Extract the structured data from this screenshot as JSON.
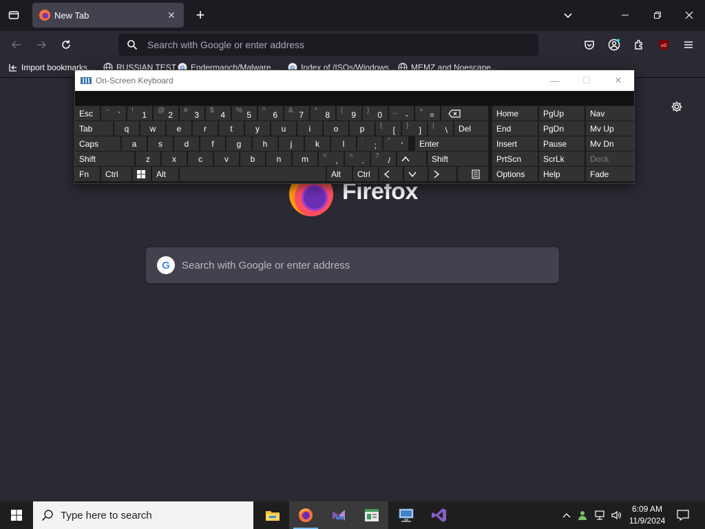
{
  "browser": {
    "tab": {
      "title": "New Tab",
      "close": "✕"
    },
    "new_tab": "+",
    "window_controls": {
      "minimize": "—",
      "restore": "❐",
      "close": "✕"
    },
    "urlbar": {
      "placeholder": "Search with Google or enter address"
    },
    "bookmarks": [
      {
        "label": "Import bookmarks...",
        "icon": "import-icon"
      },
      {
        "label": "RUSSIAN TEST",
        "icon": "globe-icon"
      },
      {
        "label": "Endermanch/Malware...",
        "icon": "google-icon"
      },
      {
        "label": "Index of /ISOs/Windows...",
        "icon": "google-icon"
      },
      {
        "label": "MEMZ and Noescape...",
        "icon": "globe-icon"
      }
    ]
  },
  "newtab": {
    "brand": "Firefox",
    "search_placeholder": "Search with Google or enter address"
  },
  "osk": {
    "title": "On-Screen Keyboard",
    "rows": {
      "row1": [
        "Esc",
        "Home",
        "PgUp",
        "Nav"
      ],
      "row2": [
        "Tab",
        "q",
        "w",
        "e",
        "r",
        "t",
        "y",
        "u",
        "i",
        "o",
        "p",
        "Del",
        "End",
        "PgDn",
        "Mv Up"
      ],
      "row3": [
        "Caps",
        "a",
        "s",
        "d",
        "f",
        "g",
        "h",
        "j",
        "k",
        "l",
        "Enter",
        "Insert",
        "Pause",
        "Mv Dn"
      ],
      "row4": [
        "Shift",
        "z",
        "x",
        "c",
        "v",
        "b",
        "n",
        "m",
        "Shift",
        "PrtScn",
        "ScrLk",
        "Dock"
      ],
      "row5": [
        "Fn",
        "Ctrl",
        "Alt",
        "Alt",
        "Ctrl",
        "Options",
        "Help",
        "Fade"
      ]
    },
    "symbols": {
      "tilde": {
        "shift": "~",
        "main": "`"
      },
      "k1": {
        "shift": "!",
        "main": "1"
      },
      "k2": {
        "shift": "@",
        "main": "2"
      },
      "k3": {
        "shift": "#",
        "main": "3"
      },
      "k4": {
        "shift": "$",
        "main": "4"
      },
      "k5": {
        "shift": "%",
        "main": "5"
      },
      "k6": {
        "shift": "^",
        "main": "6"
      },
      "k7": {
        "shift": "&",
        "main": "7"
      },
      "k8": {
        "shift": "*",
        "main": "8"
      },
      "k9": {
        "shift": "(",
        "main": "9"
      },
      "k0": {
        "shift": ")",
        "main": "0"
      },
      "minus": {
        "shift": "_",
        "main": "-"
      },
      "equal": {
        "shift": "+",
        "main": "="
      },
      "lbracket": {
        "shift": "{",
        "main": "["
      },
      "rbracket": {
        "shift": "}",
        "main": "]"
      },
      "backslash": {
        "shift": "|",
        "main": "\\"
      },
      "semicolon": {
        "shift": ":",
        "main": ";"
      },
      "quote": {
        "shift": "\"",
        "main": "'"
      },
      "comma": {
        "shift": "<",
        "main": ","
      },
      "period": {
        "shift": ">",
        "main": "."
      },
      "slash": {
        "shift": "?",
        "main": "/"
      }
    }
  },
  "taskbar": {
    "search_placeholder": "Type here to search",
    "apps": [
      "file-explorer-icon",
      "firefox-icon",
      "visual-studio-installer-icon",
      "app-icon",
      "network-app-icon",
      "visual-studio-icon"
    ],
    "clock": {
      "time": "6:09 AM",
      "date": "11/9/2024"
    }
  }
}
